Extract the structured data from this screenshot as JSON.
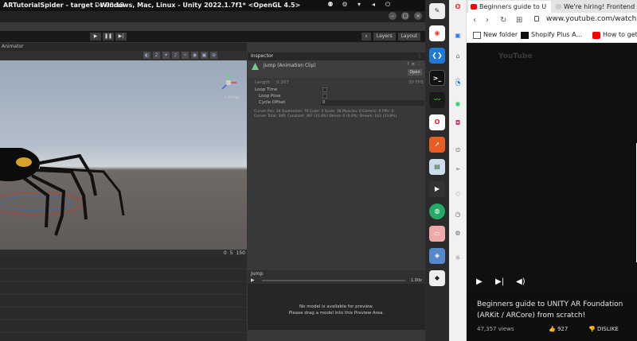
{
  "topbar": {
    "title": "ARTutorialSpider - target - Windows, Mac, Linux - Unity 2022.1.7f1* <OpenGL 4.5>",
    "clock": "Do 00:18"
  },
  "unity": {
    "toolbar": {
      "layers_label": "Layers",
      "layout_label": "Layout"
    },
    "scene_tab": "Animator",
    "console_counts": {
      "errors": "0",
      "warnings": "5",
      "messages": "150"
    },
    "gizmo_label": "< Persp"
  },
  "inspector": {
    "tab_label": "Inspector",
    "clip_name": "Jump (Animation Clip)",
    "open_label": "Open",
    "length_label": "Length",
    "length_value": "0.267",
    "fps_value": "30 FPS",
    "props": [
      {
        "label": "Loop Time"
      },
      {
        "label": "Loop Pose"
      },
      {
        "label": "Cycle Offset",
        "value": "0"
      }
    ],
    "info_line1": "Curves Pos: 38 Quaternion: 76 Euler: 0 Scale: 38 Muscles: 0 Generic: 0 PPtr: 0",
    "info_line2": "Curves Total: 340, Constant: 387 (15.8%) Dense: 0 (0.0%) Stream: 163 (33.8%)",
    "preview": {
      "name": "Jump",
      "speed": "1.00x",
      "message_line1": "No model is available for preview.",
      "message_line2": "Please drag a model into this Preview Area."
    }
  },
  "browser": {
    "tabs": [
      {
        "label": "Beginners guide to U"
      },
      {
        "label": "We're hiring! Frontend"
      }
    ],
    "url": "www.youtube.com/watch",
    "bookmarks": [
      {
        "label": "New folder"
      },
      {
        "label": "Shopify Plus A..."
      },
      {
        "label": "How to get st..."
      }
    ],
    "youtube": {
      "logo": "YouTube",
      "title": "Beginners guide to UNITY AR Foundation (ARKit / ARCore) from scratch!",
      "views": "47,357 views",
      "likes": "927",
      "dislike_label": "DISLIKE"
    }
  },
  "colors": {
    "unity_bg": "#383838",
    "dock_bg": "#2b2b2b",
    "youtube_bg": "#0f0f0f",
    "opera_red": "#e0242e"
  }
}
